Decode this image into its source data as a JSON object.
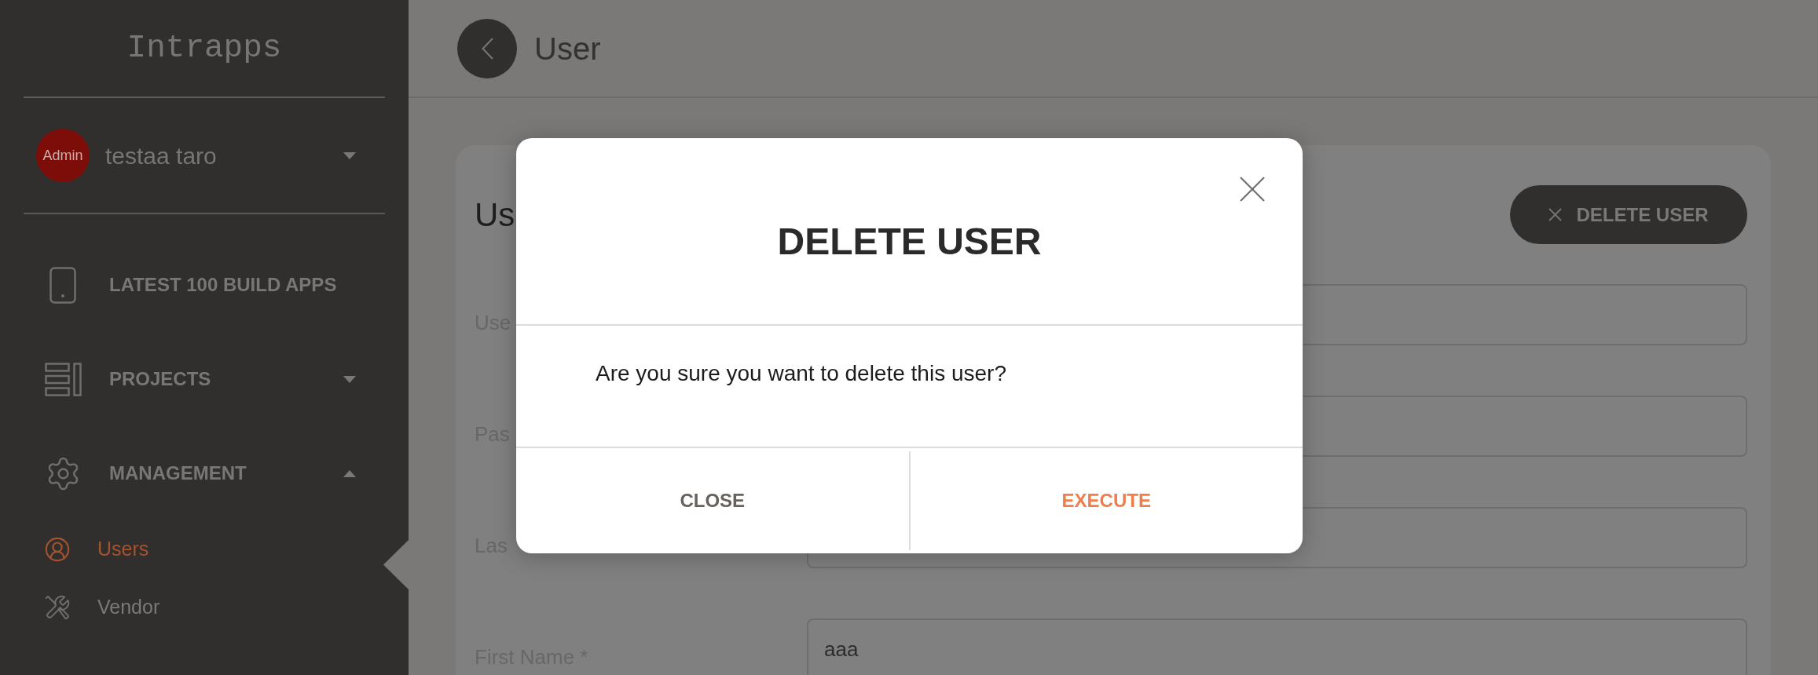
{
  "sidebar": {
    "logo": "Intrapps",
    "user": {
      "avatar_label": "Admin",
      "name": "testaa taro",
      "expanded": false
    },
    "menu": [
      {
        "label": "LATEST 100 BUILD APPS"
      },
      {
        "label": "PROJECTS",
        "expanded": false
      },
      {
        "label": "MANAGEMENT",
        "expanded": true,
        "children": [
          {
            "label": "Users",
            "selected": true
          },
          {
            "label": "Vendor",
            "selected": false
          }
        ]
      }
    ]
  },
  "header": {
    "title": "User"
  },
  "card": {
    "title": "Us",
    "delete_button": "DELETE USER",
    "fields": [
      {
        "label": "Use"
      },
      {
        "label": "Pas"
      },
      {
        "label": "Las"
      },
      {
        "label": "First Name *",
        "value": "aaa"
      }
    ]
  },
  "modal": {
    "title": "DELETE USER",
    "message": "Are you sure you want to delete this user?",
    "buttons": [
      {
        "label": "CLOSE",
        "kind": "cancel"
      },
      {
        "label": "EXECUTE",
        "kind": "confirm"
      }
    ]
  }
}
